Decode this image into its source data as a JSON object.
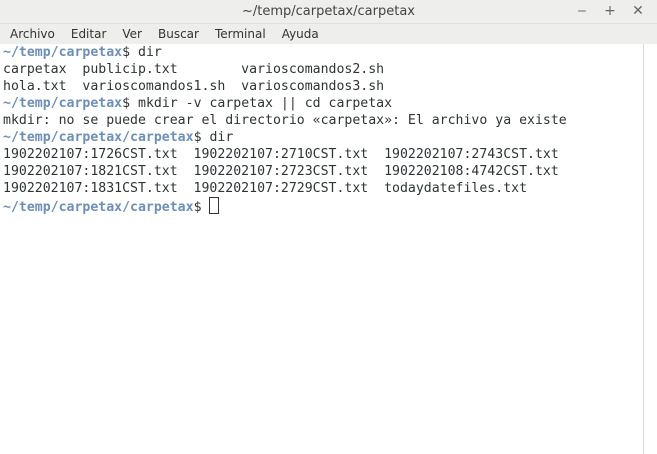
{
  "window": {
    "title": "~/temp/carpetax/carpetax",
    "buttons": {
      "minimize": "‒",
      "maximize": "+",
      "close": "✕"
    }
  },
  "menubar": {
    "items": [
      "Archivo",
      "Editar",
      "Ver",
      "Buscar",
      "Terminal",
      "Ayuda"
    ]
  },
  "terminal": {
    "prompt1": "~/temp/carpetax",
    "cmd1": "dir",
    "out1_line1": "carpetax  publicip.txt        varioscomandos2.sh",
    "out1_line2": "hola.txt  varioscomandos1.sh  varioscomandos3.sh",
    "prompt2": "~/temp/carpetax",
    "cmd2": "mkdir -v carpetax || cd carpetax",
    "out2_line1": "mkdir: no se puede crear el directorio «carpetax»: El archivo ya existe",
    "prompt3": "~/temp/carpetax/carpetax",
    "cmd3": "dir",
    "out3_line1": "1902202107:1726CST.txt  1902202107:2710CST.txt  1902202107:2743CST.txt",
    "out3_line2": "1902202107:1821CST.txt  1902202107:2723CST.txt  1902202108:4742CST.txt",
    "out3_line3": "1902202107:1831CST.txt  1902202107:2729CST.txt  todaydatefiles.txt",
    "prompt4": "~/temp/carpetax/carpetax",
    "dollar": "$"
  },
  "colors": {
    "prompt": "#6c8fb9",
    "text": "#2e3436",
    "chrome": "#eeeeec"
  }
}
